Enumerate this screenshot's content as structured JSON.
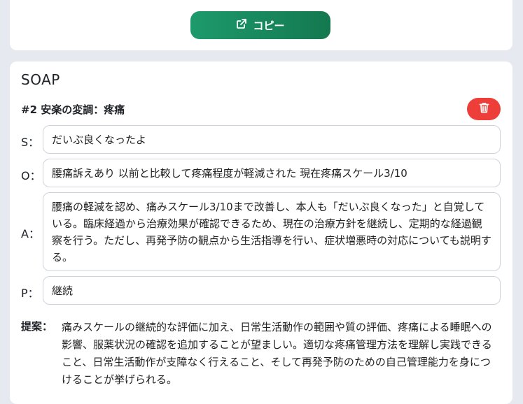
{
  "copy_button": {
    "label": "コピー",
    "icon": "external-link-icon"
  },
  "soap": {
    "title": "SOAP",
    "item_title": "#2 安楽の変調：疼痛",
    "delete_icon": "trash-icon",
    "rows": {
      "s": {
        "label": "S：",
        "value": "だいぶ良くなったよ"
      },
      "o": {
        "label": "O：",
        "value": "腰痛訴えあり 以前と比較して疼痛程度が軽減された 現在疼痛スケール3/10"
      },
      "a": {
        "label": "A：",
        "value": "腰痛の軽減を認め、痛みスケール3/10まで改善し、本人も「だいぶ良くなった」と自覚している。臨床経過から治療効果が確認できるため、現在の治療方針を継続し、定期的な経過観察を行う。ただし、再発予防の観点から生活指導を行い、症状増悪時の対応についても説明する。"
      },
      "p": {
        "label": "P：",
        "value": "継続"
      }
    },
    "suggestion": {
      "label": "提案：",
      "text": "痛みスケールの継続的な評価に加え、日常生活動作の範囲や質の評価、疼痛による睡眠への影響、服薬状況の確認を追加することが望ましい。適切な疼痛管理方法を理解し実践できること、日常生活動作が支障なく行えること、そして再発予防のための自己管理能力を身につけることが挙げられる。"
    }
  },
  "colors": {
    "copy_gradient_start": "#1d9a6c",
    "copy_gradient_end": "#14784f",
    "delete": "#ee3e3a",
    "background": "#e6e9ef"
  }
}
